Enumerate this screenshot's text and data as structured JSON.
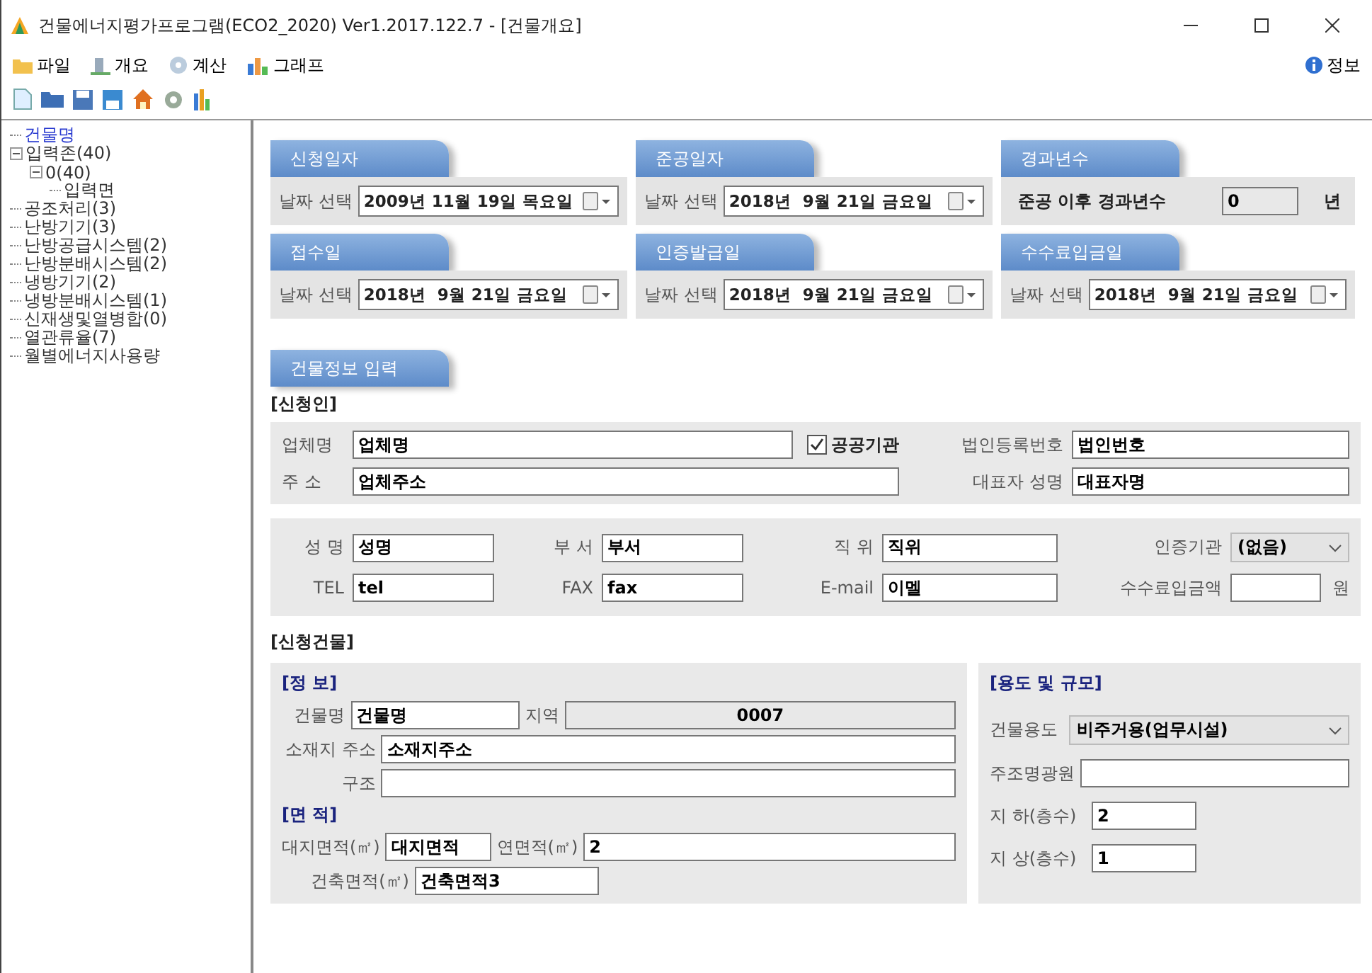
{
  "window": {
    "title": "건물에너지평가프로그램(ECO2_2020) Ver1.2017.122.7 - [건물개요]"
  },
  "menu": [
    {
      "label": "파일"
    },
    {
      "label": "개요"
    },
    {
      "label": "계산"
    },
    {
      "label": "그래프"
    }
  ],
  "info_button": {
    "label": "정보"
  },
  "tree": [
    {
      "label": "건물명",
      "selected": true
    },
    {
      "label": "입력존(40)",
      "selected": false,
      "expanded": true,
      "children": [
        {
          "label": "0(40)",
          "selected": false,
          "expanded": true,
          "children": [
            {
              "label": "입력면",
              "selected": false
            }
          ]
        }
      ]
    },
    {
      "label": "공조처리(3)",
      "selected": false
    },
    {
      "label": "난방기기(3)",
      "selected": false
    },
    {
      "label": "난방공급시스템(2)",
      "selected": false
    },
    {
      "label": "난방분배시스템(2)",
      "selected": false
    },
    {
      "label": "냉방기기(2)",
      "selected": false
    },
    {
      "label": "냉방분배시스템(1)",
      "selected": false
    },
    {
      "label": "신재생및열병합(0)",
      "selected": false
    },
    {
      "label": "열관류율(7)",
      "selected": false
    },
    {
      "label": "월별에너지사용량",
      "selected": false
    }
  ],
  "date_cards": [
    {
      "kind": "date",
      "title": "신청일자",
      "label": "날짜 선택",
      "value": "2009년 11월 19일 목요일"
    },
    {
      "kind": "date",
      "title": "준공일자",
      "label": "날짜 선택",
      "value": "2018년  9월 21일 금요일"
    },
    {
      "kind": "elapsed",
      "title": "경과년수",
      "label": "준공 이후 경과년수",
      "value": "0",
      "unit": "년"
    },
    {
      "kind": "date",
      "title": "접수일",
      "label": "날짜 선택",
      "value": "2018년  9월 21일 금요일"
    },
    {
      "kind": "date",
      "title": "인증발급일",
      "label": "날짜 선택",
      "value": "2018년  9월 21일 금요일"
    },
    {
      "kind": "date",
      "title": "수수료입금일",
      "label": "날짜 선택",
      "value": "2018년  9월 21일 금요일"
    }
  ],
  "section_tab": "건물정보 입력",
  "applicant": {
    "heading": "[신청인]",
    "company": {
      "label": "업체명",
      "value": "업체명"
    },
    "public_agency": {
      "label": "공공기관",
      "checked": true
    },
    "corp_no": {
      "label": "법인등록번호",
      "value": "법인번호"
    },
    "address": {
      "label": "주 소",
      "value": "업체주소"
    },
    "ceo": {
      "label": "대표자 성명",
      "value": "대표자명"
    },
    "contacts": [
      {
        "kind": "text",
        "label": "성 명",
        "value": "성명"
      },
      {
        "kind": "text",
        "label": "부 서",
        "value": "부서"
      },
      {
        "kind": "text",
        "label": "직 위",
        "value": "직위"
      },
      {
        "kind": "select",
        "label": "인증기관",
        "value": "(없음)"
      },
      {
        "kind": "text",
        "label": "TEL",
        "value": "tel"
      },
      {
        "kind": "text",
        "label": "FAX",
        "value": "fax"
      },
      {
        "kind": "text",
        "label": "E-mail",
        "value": "이멜"
      },
      {
        "kind": "money",
        "label": "수수료입금액",
        "unit": "원"
      }
    ]
  },
  "building": {
    "heading": "[신청건물]",
    "info": {
      "heading": "[정  보]",
      "name": {
        "label": "건물명",
        "value": "건물명"
      },
      "region": {
        "label": "지역",
        "value": "0007"
      },
      "location": {
        "label": "소재지 주소",
        "value": "소재지주소"
      },
      "structure": {
        "label": "구조"
      }
    },
    "area": {
      "heading": "[면  적]",
      "site": {
        "label": "대지면적(㎡)",
        "value": "대지면적"
      },
      "floor": {
        "label": "연면적(㎡)",
        "value": "2"
      },
      "building": {
        "label": "건축면적(㎡)",
        "value": "건축면적3"
      }
    },
    "usage": {
      "heading": "[용도 및 규모]",
      "fields": [
        {
          "kind": "select",
          "label": "건물용도",
          "value": "비주거용(업무시설)"
        },
        {
          "kind": "text",
          "label": "주조명광원"
        },
        {
          "kind": "short",
          "label": "지 하(층수)",
          "value": "2"
        },
        {
          "kind": "short",
          "label": "지 상(층수)",
          "value": "1"
        }
      ]
    }
  }
}
